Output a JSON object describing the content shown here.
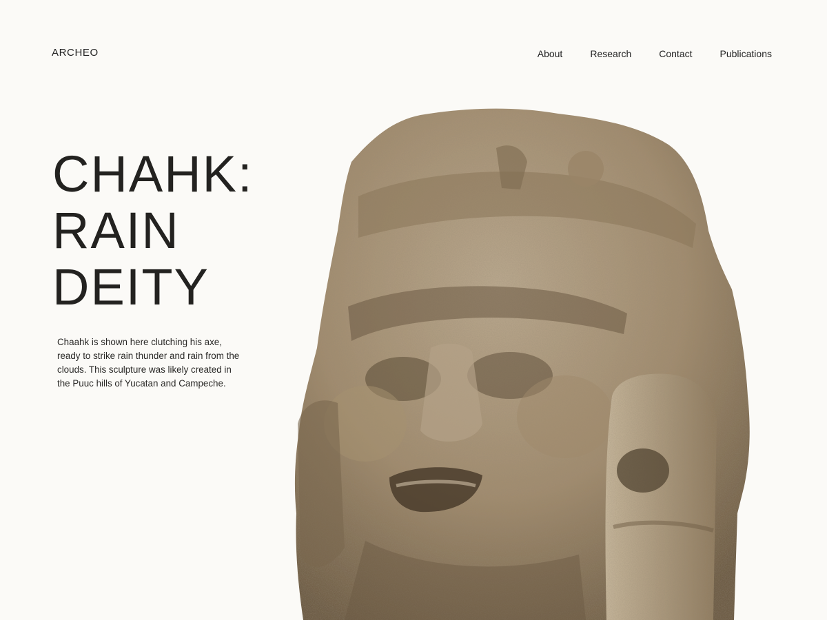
{
  "brand": "ARCHEO",
  "nav": [
    "About",
    "Research",
    "Contact",
    "Publications"
  ],
  "hero": {
    "title_lines": [
      "CHAHK:",
      "RAIN",
      "DEITY"
    ],
    "description": "Chaahk is shown here clutching his axe, ready to strike rain thunder and rain from the clouds. This sculpture was likely created in the Puuc hills of Yucatan and Campeche."
  },
  "colors": {
    "background": "#fbfaf7",
    "text": "#1f1e1c",
    "stone": "#a89478"
  },
  "image": {
    "subject": "stone-sculpture-of-chahk"
  }
}
